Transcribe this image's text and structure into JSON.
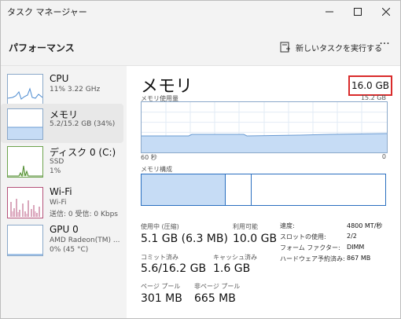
{
  "window": {
    "title": "タスク マネージャー"
  },
  "toolbar": {
    "page_heading": "パフォーマンス",
    "run_task_label": "新しいタスクを実行する",
    "more_label": "···"
  },
  "sidebar": {
    "items": [
      {
        "title": "CPU",
        "sub1": "11%  3.22 GHz",
        "sub2": ""
      },
      {
        "title": "メモリ",
        "sub1": "5.2/15.2 GB (34%)",
        "sub2": ""
      },
      {
        "title": "ディスク 0 (C:)",
        "sub1": "SSD",
        "sub2": "1%"
      },
      {
        "title": "Wi-Fi",
        "sub1": "Wi-Fi",
        "sub2": "送信: 0 受信: 0 Kbps"
      },
      {
        "title": "GPU 0",
        "sub1": "AMD Radeon(TM) ...",
        "sub2": "0%  (45 °C)"
      }
    ]
  },
  "main": {
    "title": "メモリ",
    "total": "16.0 GB",
    "usage_label": "メモリ使用量",
    "usage_max": "15.2 GB",
    "axis_left": "60 秒",
    "axis_right": "0",
    "composition_label": "メモリ構成",
    "usage_fraction": 0.34,
    "stats": {
      "in_use_label": "使用中 (圧縮)",
      "in_use_value": "5.1 GB (6.3 MB)",
      "available_label": "利用可能",
      "available_value": "10.0 GB",
      "committed_label": "コミット済み",
      "committed_value": "5.6/16.2 GB",
      "cached_label": "キャッシュ済み",
      "cached_value": "1.6 GB",
      "paged_label": "ページ プール",
      "paged_value": "301 MB",
      "nonpaged_label": "非ページ プール",
      "nonpaged_value": "665 MB"
    },
    "specs": [
      {
        "label": "速度:",
        "value": "4800 MT/秒"
      },
      {
        "label": "スロットの使用:",
        "value": "2/2"
      },
      {
        "label": "フォーム ファクター:",
        "value": "DIMM"
      },
      {
        "label": "ハードウェア予約済み:",
        "value": "867 MB"
      }
    ]
  },
  "colors": {
    "accent": "#2a6fc0",
    "graph_fill": "#c6dcf5",
    "graph_line": "#6b9bd2",
    "highlight": "#d92b2b"
  }
}
